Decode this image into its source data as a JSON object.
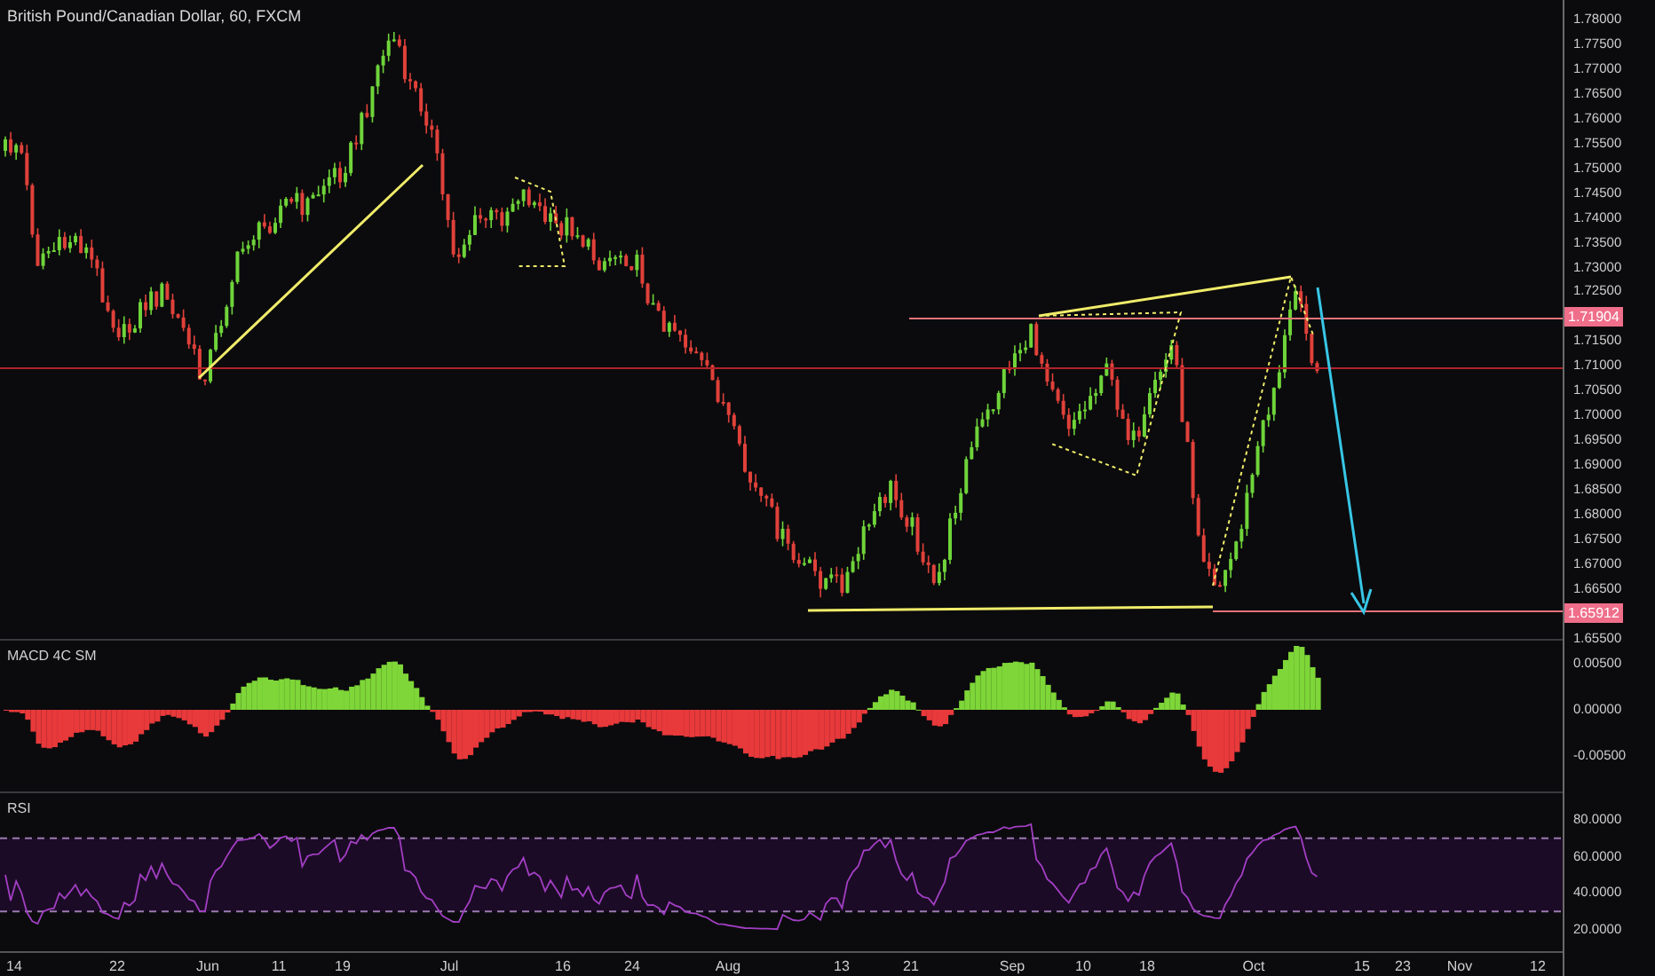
{
  "title": "British Pound/Canadian Dollar, 60, FXCM",
  "price_axis": [
    {
      "kind": "tick",
      "label": "1.78000"
    },
    {
      "kind": "tick",
      "label": "1.77500"
    },
    {
      "kind": "tick",
      "label": "1.77000"
    },
    {
      "kind": "tick",
      "label": "1.76500"
    },
    {
      "kind": "tick",
      "label": "1.76000"
    },
    {
      "kind": "tick",
      "label": "1.75500"
    },
    {
      "kind": "tick",
      "label": "1.75000"
    },
    {
      "kind": "tick",
      "label": "1.74500"
    },
    {
      "kind": "tick",
      "label": "1.74000"
    },
    {
      "kind": "tick",
      "label": "1.73500"
    },
    {
      "kind": "tick",
      "label": "1.73000"
    },
    {
      "kind": "tick",
      "label": "1.72500"
    },
    {
      "kind": "badge",
      "label": "1.71904"
    },
    {
      "kind": "tick",
      "label": "1.71500"
    },
    {
      "kind": "tick",
      "label": "1.71000"
    },
    {
      "kind": "tick",
      "label": "1.70500"
    },
    {
      "kind": "tick",
      "label": "1.70000"
    },
    {
      "kind": "tick",
      "label": "1.69500"
    },
    {
      "kind": "tick",
      "label": "1.69000"
    },
    {
      "kind": "tick",
      "label": "1.68500"
    },
    {
      "kind": "tick",
      "label": "1.68000"
    },
    {
      "kind": "tick",
      "label": "1.67500"
    },
    {
      "kind": "tick",
      "label": "1.67000"
    },
    {
      "kind": "tick",
      "label": "1.66500"
    },
    {
      "kind": "badge",
      "label": "1.65912"
    },
    {
      "kind": "tick",
      "label": "1.65500"
    }
  ],
  "macd": {
    "label": "MACD 4C SM",
    "axis": [
      "0.00500",
      "0.00000",
      "-0.00500"
    ]
  },
  "rsi": {
    "label": "RSI",
    "axis": [
      "80.0000",
      "60.0000",
      "40.0000",
      "20.0000"
    ]
  },
  "time_axis": [
    "14",
    "22",
    "Jun",
    "11",
    "19",
    "Jul",
    "16",
    "24",
    "Aug",
    "13",
    "21",
    "Sep",
    "10",
    "18",
    "Oct",
    "15",
    "23",
    "Nov",
    "12"
  ]
}
